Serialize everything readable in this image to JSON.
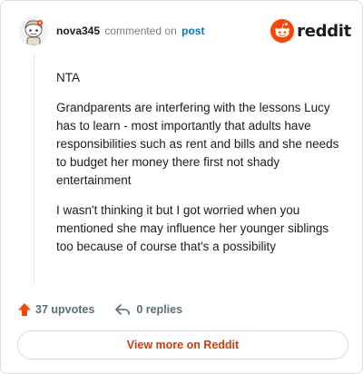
{
  "header": {
    "username": "nova345",
    "action_text": "commented on",
    "post_link": "post",
    "brand_name": "reddit"
  },
  "comment": {
    "paragraphs": [
      "NTA",
      "Grandparents are interfering with the lessons Lucy has to learn - most importantly that adults have responsibilities such as rent and bills and she needs to budget her money there first not shady entertainment",
      "I wasn't thinking it but I got worried when you mentioned she may influence her younger siblings too because of course that's a possibility"
    ]
  },
  "actions": {
    "upvotes": "37 upvotes",
    "replies": "0 replies"
  },
  "footer": {
    "view_more_label": "View more on Reddit"
  },
  "colors": {
    "brand": "#ff4500",
    "link": "#0079d3",
    "cta_text": "#d93a00",
    "muted": "#576f76"
  },
  "icons": {
    "avatar": "snoo-avatar",
    "brand": "reddit-logo-icon",
    "upvote": "upvote-arrow-icon",
    "reply": "reply-arrow-icon"
  }
}
